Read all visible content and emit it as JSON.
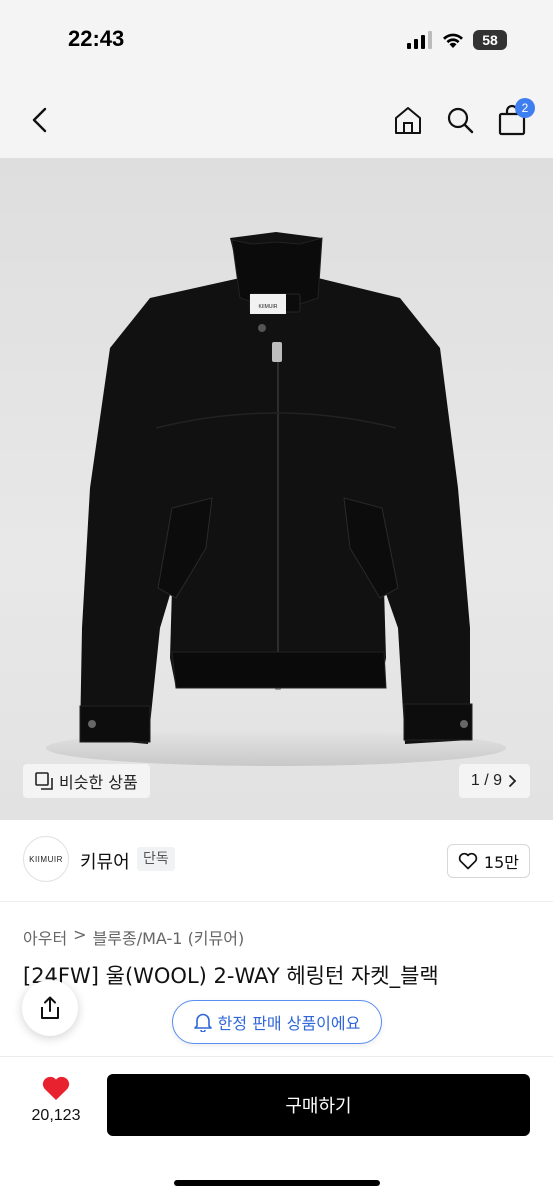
{
  "status_bar": {
    "time": "22:43",
    "battery": "58"
  },
  "nav": {
    "cart_badge": "2"
  },
  "image": {
    "similar_label": "비슷한 상품",
    "counter": "1 / 9",
    "brand_tag_on_jacket": "KIIMUIR"
  },
  "brand": {
    "logo_text": "KIIMUIR",
    "name": "키뮤어",
    "tag": "단독",
    "likes": "15만"
  },
  "breadcrumb": [
    "아우터",
    ">",
    "블루종/MA-1 (키뮤어)"
  ],
  "product": {
    "title": "[24FW] 울(WOOL) 2-WAY 헤링턴 자켓_블랙"
  },
  "limited_banner": "한정 판매 상품이에요",
  "bottom": {
    "wish_count": "20,123",
    "buy_label": "구매하기"
  },
  "colors": {
    "accent_blue": "#3f7ef0",
    "heart_red": "#e8232f",
    "buy_button": "#000000"
  }
}
